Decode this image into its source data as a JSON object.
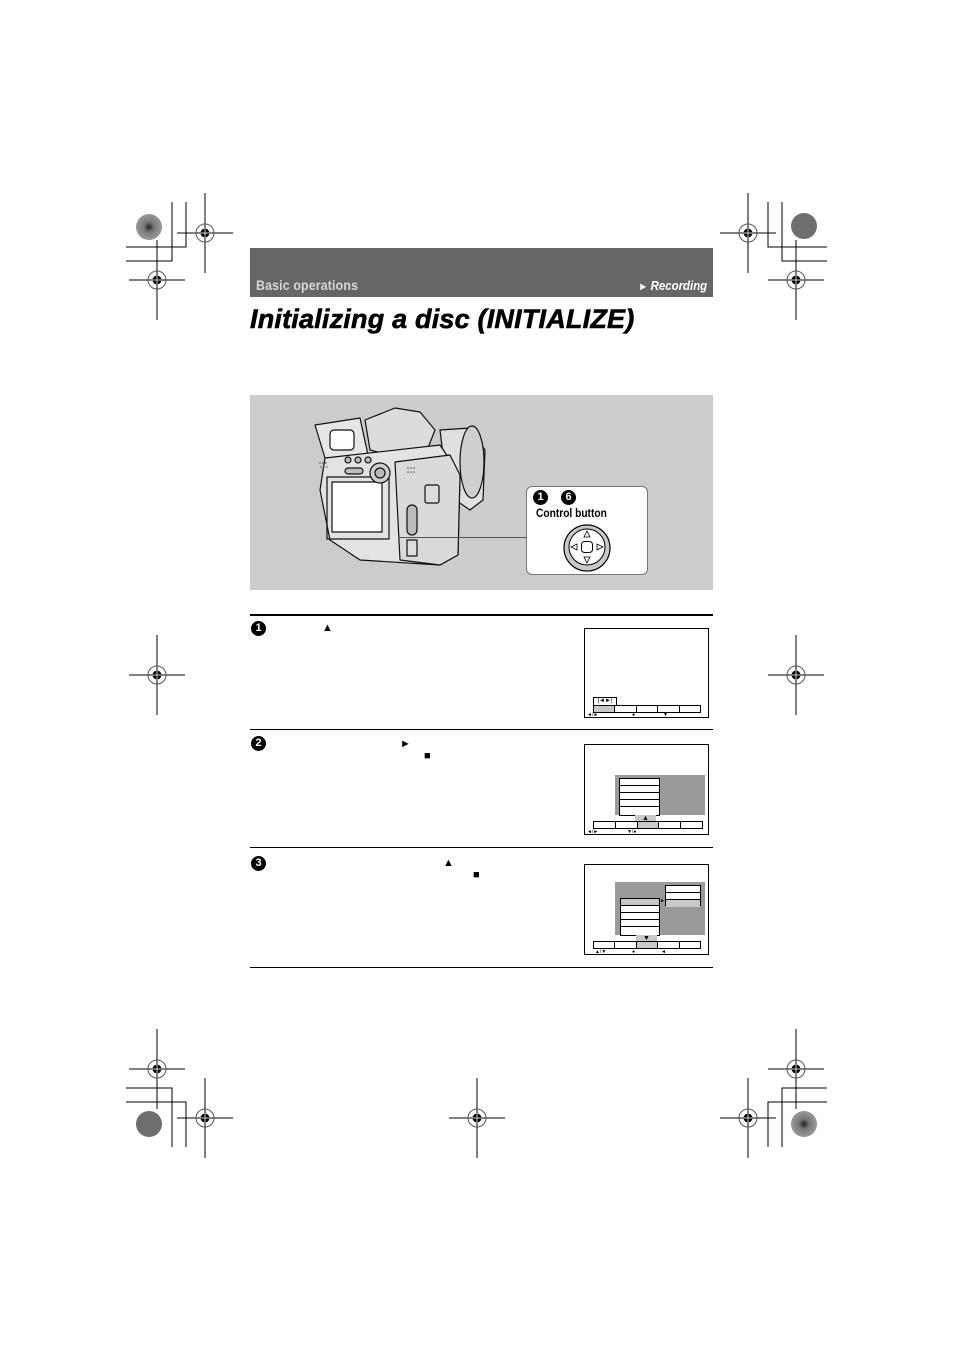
{
  "header": {
    "section": "Basic operations",
    "subsection_arrow": "►",
    "subsection": "Recording",
    "bar_color": "#666666"
  },
  "title": "Initializing a disc (INITIALIZE)",
  "illustration": {
    "callout": {
      "step_refs": [
        "1",
        "6"
      ],
      "label": "Control button"
    },
    "panel_color": "#cccccc"
  },
  "steps": [
    {
      "number": "1",
      "glyphs": [
        "▲"
      ],
      "screen": {
        "icons": [
          "|◄",
          "►|"
        ],
        "menu_cells": 5,
        "active_cell": 0,
        "hints": [
          "◄/►",
          "●",
          "▼"
        ]
      }
    },
    {
      "number": "2",
      "glyphs": [
        "►",
        "■"
      ],
      "screen": {
        "menu_cells": 5,
        "active_cell": 2,
        "tab_arrow": "▲",
        "submenu_rows": 5,
        "hints": [
          "◄/►",
          "▼/●"
        ]
      }
    },
    {
      "number": "3",
      "glyphs": [
        "▲",
        "■"
      ],
      "screen": {
        "menu_cells": 5,
        "active_cell": 2,
        "tab_arrow": "▼",
        "submenu_rows": 5,
        "selected_row": 0,
        "pointer": "►",
        "option_rows": 3,
        "selected_option": 2,
        "hints": [
          "▲/▼",
          "●",
          "◄"
        ]
      }
    }
  ]
}
